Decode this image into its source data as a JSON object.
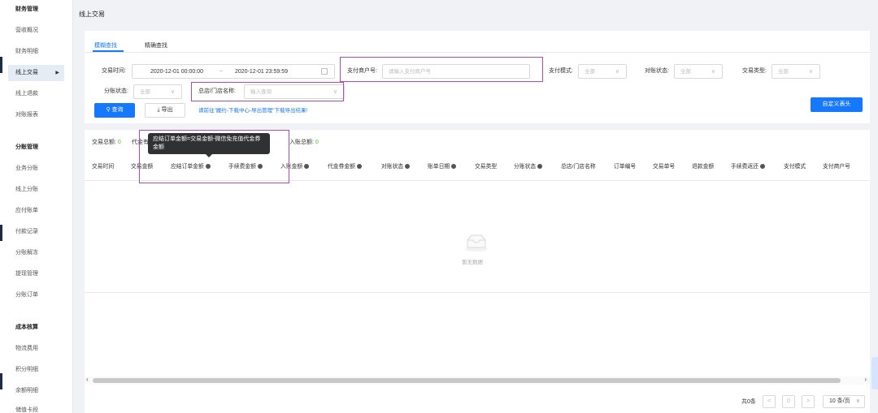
{
  "sidebar": {
    "items": [
      {
        "label": "财务管理",
        "group": true
      },
      {
        "label": "营收概况"
      },
      {
        "label": "财务明细"
      },
      {
        "label": "线上交易",
        "active": true
      },
      {
        "label": "线上退款"
      },
      {
        "label": "对账报表"
      },
      {
        "label": "分账管理",
        "group": true
      },
      {
        "label": "业务分账"
      },
      {
        "label": "线上分账"
      },
      {
        "label": "应付账单"
      },
      {
        "label": "付款记录"
      },
      {
        "label": "分账解冻"
      },
      {
        "label": "提现管理"
      },
      {
        "label": "分账订单"
      },
      {
        "label": "成本核算",
        "group": true
      },
      {
        "label": "物流费用"
      },
      {
        "label": "积分明细"
      },
      {
        "label": "余额明细"
      },
      {
        "label": "储值卡段"
      }
    ]
  },
  "page": {
    "title": "线上交易"
  },
  "tabs": [
    "模糊查找",
    "精确查找"
  ],
  "filters": {
    "trade_time_label": "交易时间:",
    "start_time": "2020-12-01 00:00:00",
    "range_sep": "~",
    "end_time": "2020-12-01 23:59:59",
    "merchant_no_label": "支付商户号:",
    "merchant_no_placeholder": "请输入支付商户号",
    "pay_mode_label": "支付模式:",
    "pay_mode_value": "全部",
    "recon_status_label": "对账状态:",
    "recon_status_value": "全部",
    "trade_type_label": "交易类型:",
    "trade_type_value": "全部",
    "split_status_label": "分账状态:",
    "split_status_value": "全部",
    "store_label": "总店/门店名称:",
    "store_placeholder": "输入查询"
  },
  "actions": {
    "query": "查询",
    "export": "导出",
    "export_hint": "请前往\"履约-下载中心-导出管理\"下载导出结果!",
    "custom_header": "自定义表头"
  },
  "summary": {
    "total_label": "交易总额:",
    "total_value": "0",
    "voucher_label": "代金有",
    "income_label": "入账总额:",
    "income_value": "0"
  },
  "tooltip": "应结订单金额=交易金额-微信免充值代金券金额",
  "columns": [
    {
      "label": "交易时间"
    },
    {
      "label": "交易金额"
    },
    {
      "label": "应结订单金额",
      "help": true
    },
    {
      "label": "手续费金额",
      "help": true
    },
    {
      "label": "入账金额",
      "help": true
    },
    {
      "label": "代金券金额",
      "help": true
    },
    {
      "label": "对账状态",
      "help": true
    },
    {
      "label": "账单日期",
      "help": true
    },
    {
      "label": "交易类型"
    },
    {
      "label": "分账状态",
      "help": true
    },
    {
      "label": "总店/门店名称"
    },
    {
      "label": "订单编号"
    },
    {
      "label": "交易单号"
    },
    {
      "label": "退款金额"
    },
    {
      "label": "手续费返还",
      "help": true
    },
    {
      "label": "支付模式"
    },
    {
      "label": "支付商户号"
    }
  ],
  "empty_text": "暂无数据",
  "pagination": {
    "total": "共0条",
    "prev": "<",
    "page": "0",
    "next": ">",
    "page_size": "10 条/页"
  }
}
